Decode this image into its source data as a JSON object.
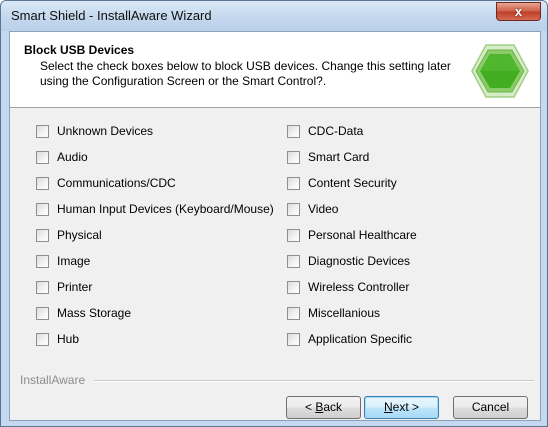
{
  "window": {
    "title": "Smart Shield - InstallAware Wizard",
    "close_glyph": "x"
  },
  "header": {
    "title": "Block USB Devices",
    "description": "Select the check boxes below to block USB devices.  Change this setting later using the Configuration Screen or the Smart Control?.",
    "logo_icon": "green-hexagon-icon",
    "logo_color": "#3fae2a"
  },
  "devices_left": [
    {
      "label": "Unknown Devices",
      "checked": false
    },
    {
      "label": "Audio",
      "checked": false
    },
    {
      "label": "Communications/CDC",
      "checked": false
    },
    {
      "label": "Human Input Devices (Keyboard/Mouse)",
      "checked": false
    },
    {
      "label": "Physical",
      "checked": false
    },
    {
      "label": "Image",
      "checked": false
    },
    {
      "label": "Printer",
      "checked": false
    },
    {
      "label": "Mass Storage",
      "checked": false
    },
    {
      "label": "Hub",
      "checked": false
    }
  ],
  "devices_right": [
    {
      "label": "CDC-Data",
      "checked": false
    },
    {
      "label": "Smart Card",
      "checked": false
    },
    {
      "label": "Content Security",
      "checked": false
    },
    {
      "label": "Video",
      "checked": false
    },
    {
      "label": "Personal Healthcare",
      "checked": false
    },
    {
      "label": "Diagnostic Devices",
      "checked": false
    },
    {
      "label": "Wireless Controller",
      "checked": false
    },
    {
      "label": "Miscellanious",
      "checked": false
    },
    {
      "label": "Application Specific",
      "checked": false
    }
  ],
  "footer": {
    "brand": "InstallAware",
    "back_prefix": "< ",
    "back_accel": "B",
    "back_rest": "ack",
    "next_accel": "N",
    "next_rest": "ext >",
    "cancel_label": "Cancel"
  }
}
